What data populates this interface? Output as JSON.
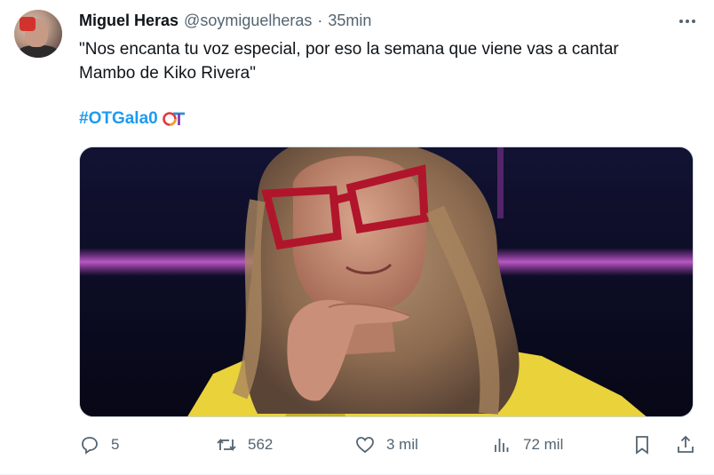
{
  "tweet": {
    "author_name": "Miguel Heras",
    "author_handle": "@soymiguelheras",
    "separator": "·",
    "time": "35min",
    "text_line1": "\"Nos encanta tu voz especial, por eso la semana que viene vas a cantar",
    "text_line2": "Mambo de Kiko Rivera\"",
    "hashtag": "#OTGala0",
    "hashtag_emoji": "OT-logo-icon"
  },
  "actions": {
    "replies": "5",
    "retweets": "562",
    "likes": "3 mil",
    "views": "72 mil"
  },
  "colors": {
    "link": "#1d9bf0",
    "muted": "#536471",
    "text": "#0f1419",
    "media_background": "#0b0b22",
    "stage_light": "#d34bd8",
    "jacket": "#e9d23a",
    "glasses": "#b1152b"
  }
}
